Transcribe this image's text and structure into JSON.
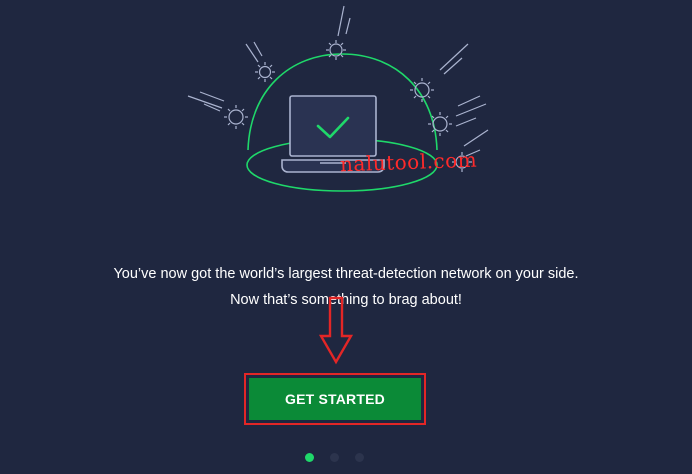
{
  "welcome": {
    "line1": "You’ve now got the world’s largest threat-detection network on your side.",
    "line2": "Now that’s something to brag about!"
  },
  "cta": {
    "label": "GET STARTED"
  },
  "pagination": {
    "pages": 3,
    "active_index": 0
  },
  "overlay": {
    "watermark_text": "nalutool.com"
  },
  "colors": {
    "background": "#1f2740",
    "shield_green": "#1fd86a",
    "button_green": "#0b8a37",
    "annotation_red": "#e32626"
  }
}
